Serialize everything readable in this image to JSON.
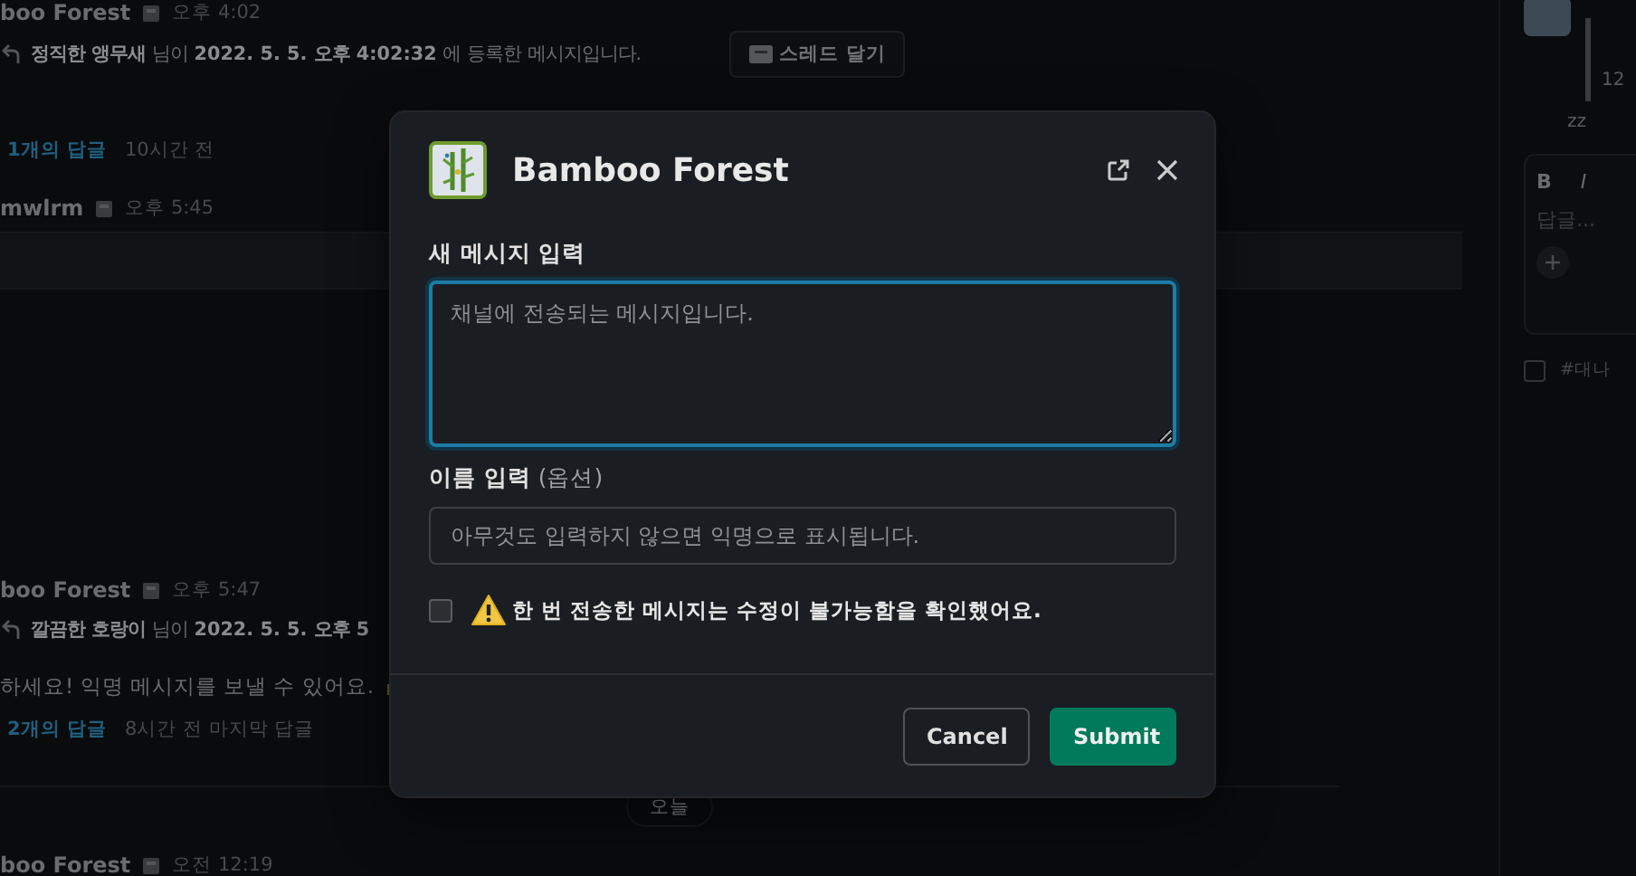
{
  "feed": [
    {
      "kind": "author",
      "name": "boo Forest",
      "time": "오후 4:02"
    },
    {
      "kind": "notice",
      "text": "**정직한 앵무새** 님이 **2022. 5. 5. 오후 4:02:32** 에 등록한 메시지입니다.",
      "button": "스레드 달기"
    },
    {
      "kind": "replies",
      "link": "1개의 답글",
      "meta": "10시간 전"
    },
    {
      "kind": "author",
      "name": "mwlrm",
      "time": "오후 5:45"
    },
    {
      "kind": "bar"
    },
    {
      "kind": "author",
      "name": "boo Forest",
      "time": "오후 5:47"
    },
    {
      "kind": "notice",
      "text": "**깔끔한 호랑이** 님이 **2022. 5. 5. 오후 5**"
    },
    {
      "kind": "text",
      "text": "하세요! 익명 메시지를 보낼 수 있어요."
    },
    {
      "kind": "replies",
      "link": "2개의 답글",
      "meta": "8시간 전 마지막 답글"
    },
    {
      "kind": "divider",
      "label": "오늘"
    },
    {
      "kind": "author",
      "name": "boo Forest",
      "time": "오전 12:19"
    }
  ],
  "thread_panel": {
    "quote": "12",
    "reply": "zz",
    "composer": {
      "format_buttons": [
        "B",
        "I"
      ],
      "placeholder": "답글..."
    },
    "also_send": {
      "label": "#대나",
      "checked": false
    }
  },
  "modal": {
    "title": "Bamboo Forest",
    "message_field": {
      "label": "새 메시지 입력",
      "placeholder": "채널에 전송되는 메시지입니다.",
      "focused": true
    },
    "name_field": {
      "label": "**이름 입력** (옵션)",
      "placeholder": "아무것도 입력하지 않으면 익명으로 표시됩니다."
    },
    "confirm": {
      "label": "한 번 전송한 메시지는 수정이 불가능함을 확인했어요.",
      "checked": false
    },
    "buttons": [
      {
        "label": "Cancel",
        "kind": "secondary"
      },
      {
        "label": "Submit",
        "kind": "primary"
      }
    ]
  }
}
